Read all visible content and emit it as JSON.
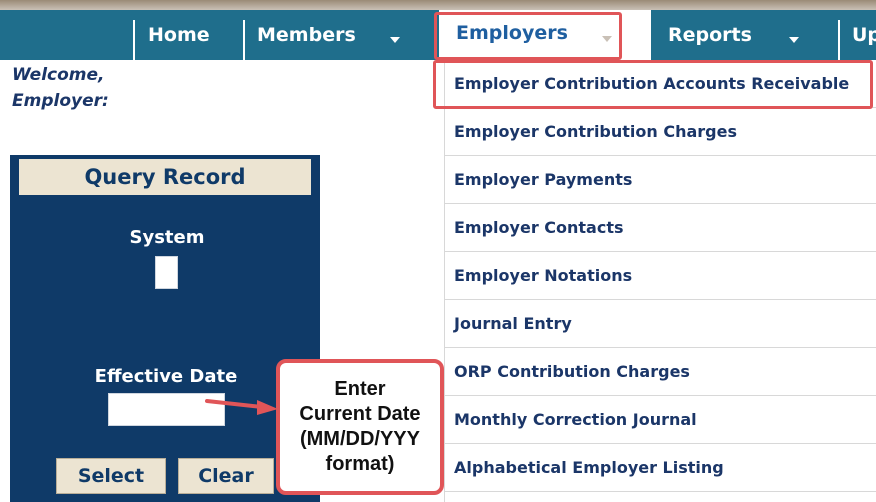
{
  "nav": {
    "items": [
      {
        "label": "Home"
      },
      {
        "label": "Members"
      },
      {
        "label": "Employers"
      },
      {
        "label": "Reports"
      },
      {
        "label": "Up"
      }
    ]
  },
  "welcome": {
    "line1": "Welcome,",
    "line2": "Employer:"
  },
  "query": {
    "title": "Query Record",
    "system_label": "System",
    "system_value": "",
    "effective_date_label": "Effective Date",
    "effective_date_value": "",
    "select_label": "Select",
    "clear_label": "Clear"
  },
  "dropdown": {
    "items": [
      "Employer Contribution Accounts Receivable",
      "Employer Contribution Charges",
      "Employer Payments",
      "Employer Contacts",
      "Employer Notations",
      "Journal Entry",
      "ORP Contribution Charges",
      "Monthly Correction Journal",
      "Alphabetical Employer Listing"
    ]
  },
  "callout": {
    "line1": "Enter",
    "line2": "Current Date",
    "line3": "(MM/DD/YYY",
    "line4": "format)"
  },
  "colors": {
    "nav_bg": "#1f6e8c",
    "panel_bg": "#0f3a68",
    "panel_header_bg": "#ece4d2",
    "menu_text": "#1b3668",
    "highlight": "#e05558"
  }
}
